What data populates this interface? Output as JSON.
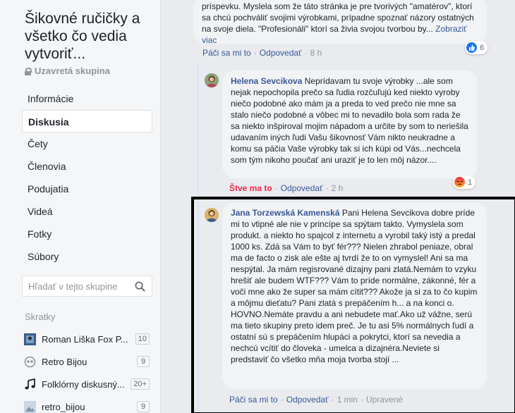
{
  "group": {
    "title": "Šikovné ručičky a všetko čo vedia vytvoriť...",
    "privacy": "Uzavretá skupina"
  },
  "nav": {
    "items": [
      {
        "label": "Informácie",
        "active": false
      },
      {
        "label": "Diskusia",
        "active": true
      },
      {
        "label": "Čety",
        "active": false
      },
      {
        "label": "Členovia",
        "active": false
      },
      {
        "label": "Podujatia",
        "active": false
      },
      {
        "label": "Videá",
        "active": false
      },
      {
        "label": "Fotky",
        "active": false
      },
      {
        "label": "Súbory",
        "active": false
      }
    ]
  },
  "search": {
    "placeholder": "Hľadať v tejto skupine"
  },
  "shortcuts": {
    "title": "Skratky",
    "items": [
      {
        "label": "Roman Liška Fox P...",
        "count": "10",
        "icon": "photo-icon"
      },
      {
        "label": "Retro Bijou",
        "count": "9",
        "icon": "group-icon"
      },
      {
        "label": "Folklórny diskusný...",
        "count": "20+",
        "icon": "music-note-icon"
      },
      {
        "label": "retro_bijou",
        "count": "9",
        "icon": "photo-icon"
      }
    ]
  },
  "comments": [
    {
      "author": "",
      "text": "príspevku. Myslela som že táto stránka je pre tvorivých \"amatérov\", ktorí sa chcú pochváliť svojimi výrobkami, prípadne spoznať názory ostatných na svoje diela. \"Profesionáli\" ktorí sa živia svojou tvorbou by...",
      "more": "Zobraziť viac",
      "like": "Páči sa mi to",
      "reply": "Odpovedať",
      "time": "8 h",
      "reaction_count": "6",
      "reaction": "like",
      "colors": {
        "reaction": "#1877f2"
      }
    },
    {
      "author": "Helena Sevcikova",
      "text": "Neprídavam tu svoje výrobky ...ale som nejak nepochopila prečo sa ľudia rozčuľujú ked niekto vyroby niečo podobné ako mám ja a preda to ved prečo nie mne sa stalo niečo podobné a vôbec mi to nevadilo bola som rada že sa niekto inšpiroval mojim nápadom a určite by som to neriešila udavaním iných ľudi Vašu šikovnosť Vám nikto neukradne a komu sa páčia Vaše výrobky tak si ich kúpi od Vás...nechcela som tým nikoho poučať ani uraziť je to len môj názor....",
      "like": "Štve ma to",
      "reply": "Odpovedať",
      "time": "2 h",
      "reaction_count": "1",
      "reaction": "angry",
      "colors": {
        "reaction": "#f0284a"
      }
    },
    {
      "author": "Jana Torzewská Kamenská",
      "text": "Pani Helena Sevcikova dobre príde mi to vtipné ale nie v princípe sa spýtam takto. Vymyslela som produkt. a niekto ho spajcol z internetu a vyrobil taký istý a predal 1000 ks. Zdá sa Vám to byť fér??? Nielen zhrabol peniaze, obral ma de facto o zisk ale ešte aj tvrdí že to on vymyslel! Ani sa ma nespýtal. Ja mám regisrované dizajny pani zlatá.Nemám to vzyku hrešiť ale budem WTF??? Vám to príde normálne, zákonné, fér a voči mne ako že super sa mám cítit??? Akože ja si za to čo kupim a môjmu dieťatu? Pani zlatá s prepáčením h... a na konci o. HOVNO.Nemáte pravdu a ani nebudete mať.Ako už vážne, serú ma tieto skupiny preto idem preč. Je tu asi 5% normálnych ľudí a ostatní sú s prepáčením hlupáci a pokrytci, ktorí sa nevedia a nechcú vcítiť do človeka - umelca a dizajnéra.Neviete si predstaviť čo všetko mňa moja tvorba stojí ...",
      "like": "Páči sa mi to",
      "reply": "Odpovedať",
      "time": "1 min",
      "edited": "Upravené"
    }
  ],
  "colors": {
    "link": "#385898",
    "muted": "#90949c",
    "bubble": "#f2f3f5",
    "sidebar_bg": "#f5f6f7",
    "feed_bg": "#e9ebee"
  }
}
